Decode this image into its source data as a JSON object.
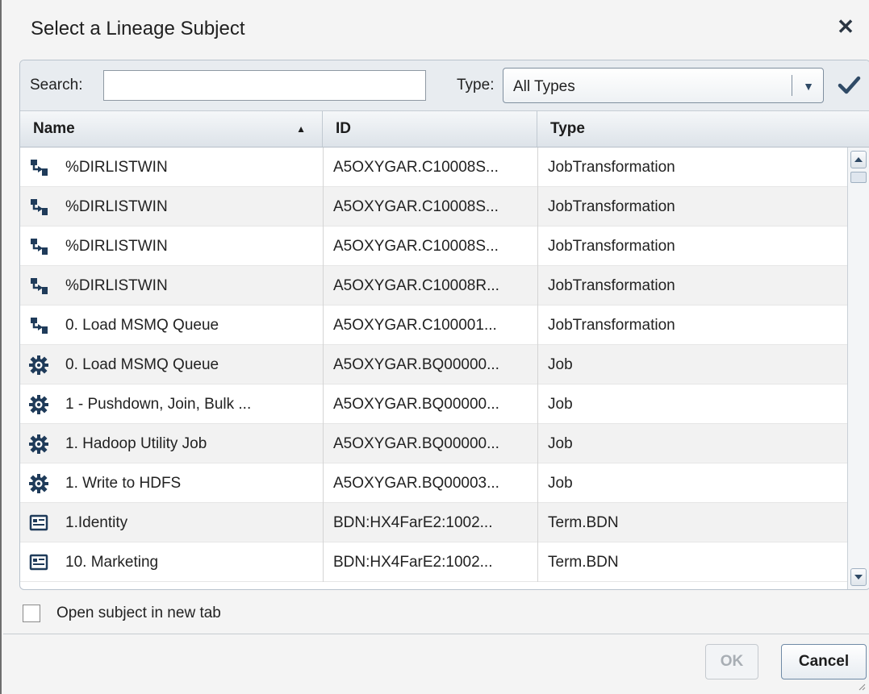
{
  "dialog": {
    "title": "Select a Lineage Subject",
    "close_icon": "close-icon"
  },
  "search": {
    "label": "Search:",
    "value": "",
    "placeholder": ""
  },
  "type_filter": {
    "label": "Type:",
    "selected": "All Types",
    "apply_icon": "checkmark-icon"
  },
  "table": {
    "columns": [
      "Name",
      "ID",
      "Type"
    ],
    "sorted_column": "Name",
    "sort_direction": "ascending",
    "rows": [
      {
        "icon": "job-transformation-icon",
        "name": "%DIRLISTWIN",
        "id": "A5OXYGAR.C10008S...",
        "type": "JobTransformation"
      },
      {
        "icon": "job-transformation-icon",
        "name": "%DIRLISTWIN",
        "id": "A5OXYGAR.C10008S...",
        "type": "JobTransformation"
      },
      {
        "icon": "job-transformation-icon",
        "name": "%DIRLISTWIN",
        "id": "A5OXYGAR.C10008S...",
        "type": "JobTransformation"
      },
      {
        "icon": "job-transformation-icon",
        "name": "%DIRLISTWIN",
        "id": "A5OXYGAR.C10008R...",
        "type": "JobTransformation"
      },
      {
        "icon": "job-transformation-icon",
        "name": "0. Load MSMQ Queue",
        "id": "A5OXYGAR.C100001...",
        "type": "JobTransformation"
      },
      {
        "icon": "job-gear-icon",
        "name": "0. Load MSMQ Queue",
        "id": "A5OXYGAR.BQ00000...",
        "type": "Job"
      },
      {
        "icon": "job-gear-icon",
        "name": "1 - Pushdown, Join,  Bulk ...",
        "id": "A5OXYGAR.BQ00000...",
        "type": "Job"
      },
      {
        "icon": "job-gear-icon",
        "name": "1. Hadoop Utility Job",
        "id": "A5OXYGAR.BQ00000...",
        "type": "Job"
      },
      {
        "icon": "job-gear-icon",
        "name": "1. Write to HDFS",
        "id": "A5OXYGAR.BQ00003...",
        "type": "Job"
      },
      {
        "icon": "term-card-icon",
        "name": "1.Identity",
        "id": "BDN:HX4FarE2:1002...",
        "type": "Term.BDN"
      },
      {
        "icon": "term-card-icon",
        "name": "10. Marketing",
        "id": "BDN:HX4FarE2:1002...",
        "type": "Term.BDN"
      }
    ]
  },
  "options": {
    "open_in_new_tab_label": "Open subject in new tab",
    "open_in_new_tab_checked": false
  },
  "buttons": {
    "ok": "OK",
    "cancel": "Cancel",
    "ok_enabled": false
  },
  "colors": {
    "accent": "#2f4a66",
    "header_bg": "#e8ecf0",
    "row_alt": "#f2f2f2"
  }
}
